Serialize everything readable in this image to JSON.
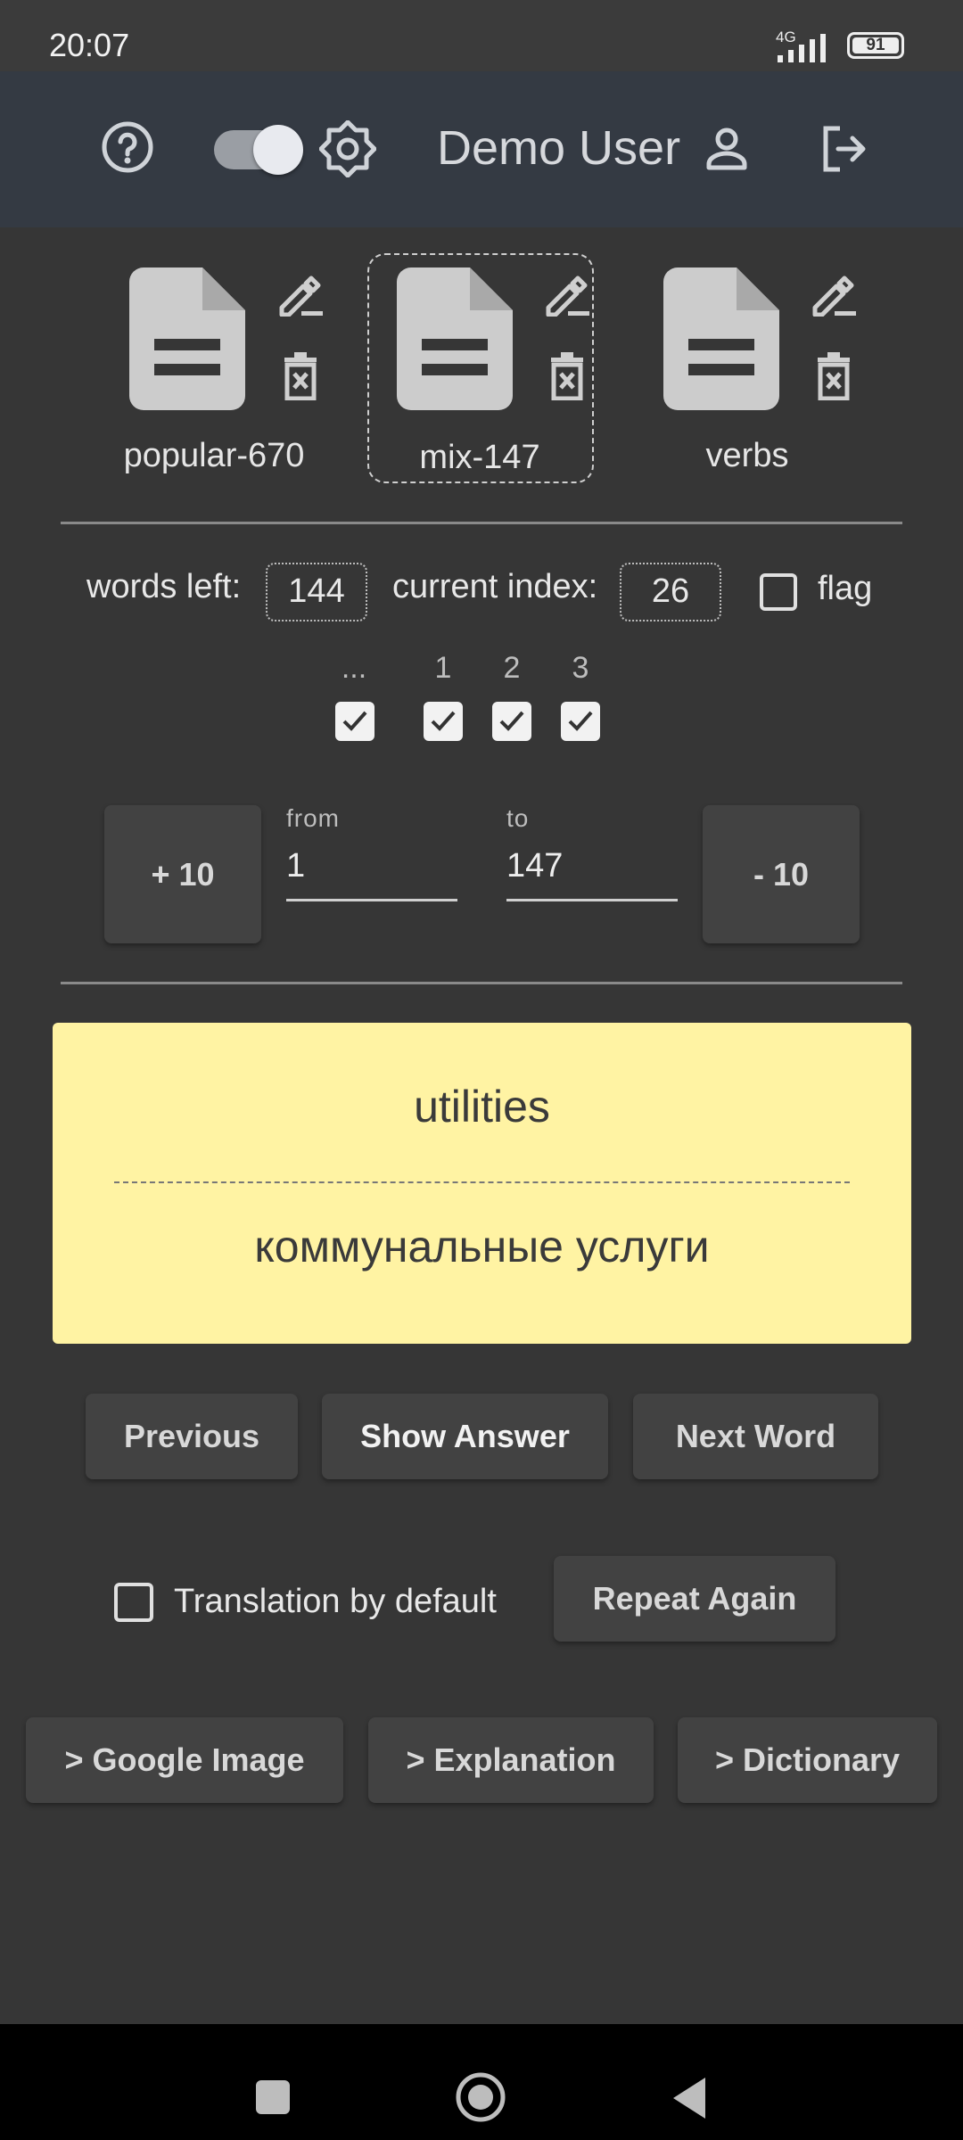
{
  "status_bar": {
    "time": "20:07",
    "network": "4G",
    "battery": "91"
  },
  "header": {
    "user_name": "Demo User",
    "theme_toggle_on": true
  },
  "files": [
    {
      "name": "popular-670",
      "selected": false
    },
    {
      "name": "mix-147",
      "selected": true
    },
    {
      "name": "verbs",
      "selected": false
    }
  ],
  "stats": {
    "words_left_label": "words left:",
    "words_left": "144",
    "current_index_label": "current index:",
    "current_index": "26",
    "flag_label": "flag",
    "flag_checked": false
  },
  "levels": [
    {
      "label": "...",
      "checked": true
    },
    {
      "label": "1",
      "checked": true
    },
    {
      "label": "2",
      "checked": true
    },
    {
      "label": "3",
      "checked": true
    }
  ],
  "range": {
    "plus_label": "+ 10",
    "minus_label": "- 10",
    "from_label": "from",
    "from_value": "1",
    "to_label": "to",
    "to_value": "147"
  },
  "card": {
    "word": "utilities",
    "translation": "коммунальные услуги",
    "background": "#fff3a3"
  },
  "actions": {
    "previous": "Previous",
    "show_answer": "Show Answer",
    "next_word": "Next Word",
    "translation_default_label": "Translation by default",
    "translation_default_checked": false,
    "repeat_again": "Repeat Again",
    "google_image": "> Google Image",
    "explanation": "> Explanation",
    "dictionary": "> Dictionary"
  }
}
